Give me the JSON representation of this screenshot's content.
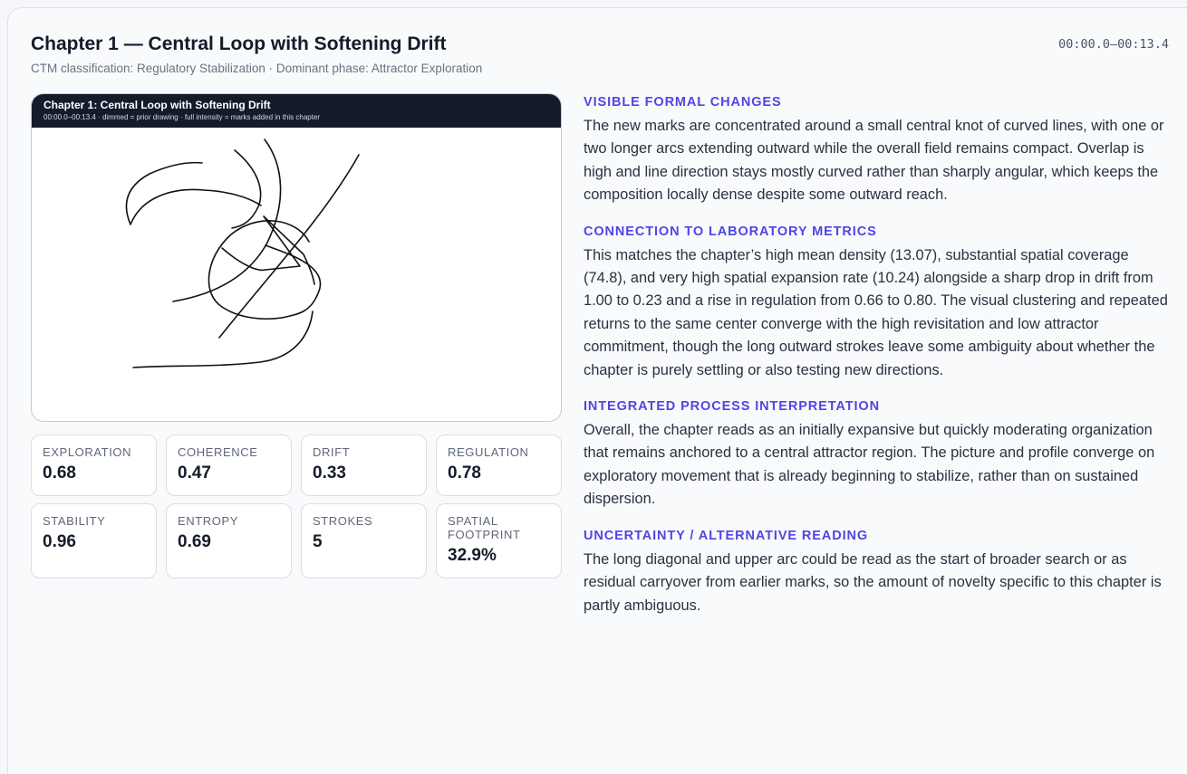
{
  "header": {
    "title": "Chapter 1 — Central Loop with Softening Drift",
    "time_range": "00:00.0–00:13.4",
    "subtitle": "CTM classification: Regulatory Stabilization · Dominant phase: Attractor Exploration"
  },
  "drawing": {
    "title": "Chapter 1: Central Loop with Softening Drift",
    "caption": "00:00.0–00:13.4  ·  dimmed = prior drawing  ·  full intensity = marks added in this chapter",
    "stroke_color": "#111111"
  },
  "metrics": [
    {
      "label": "Exploration",
      "value": "0.68"
    },
    {
      "label": "Coherence",
      "value": "0.47"
    },
    {
      "label": "Drift",
      "value": "0.33"
    },
    {
      "label": "Regulation",
      "value": "0.78"
    },
    {
      "label": "Stability",
      "value": "0.96"
    },
    {
      "label": "Entropy",
      "value": "0.69"
    },
    {
      "label": "Strokes",
      "value": "5"
    },
    {
      "label": "Spatial Footprint",
      "value": "32.9%"
    }
  ],
  "sections": [
    {
      "heading": "Visible Formal Changes",
      "body": "The new marks are concentrated around a small central knot of curved lines, with one or two longer arcs extending outward while the overall field remains compact. Overlap is high and line direction stays mostly curved rather than sharply angular, which keeps the composition locally dense despite some outward reach."
    },
    {
      "heading": "Connection to Laboratory Metrics",
      "body": "This matches the chapter’s high mean density (13.07), substantial spatial coverage (74.8), and very high spatial expansion rate (10.24) alongside a sharp drop in drift from 1.00 to 0.23 and a rise in regulation from 0.66 to 0.80. The visual clustering and repeated returns to the same center converge with the high revisitation and low attractor commitment, though the long outward strokes leave some ambiguity about whether the chapter is purely settling or also testing new directions."
    },
    {
      "heading": "Integrated Process Interpretation",
      "body": "Overall, the chapter reads as an initially expansive but quickly moderating organization that remains anchored to a central attractor region. The picture and profile converge on exploratory movement that is already beginning to stabilize, rather than on sustained dispersion."
    },
    {
      "heading": "Uncertainty / Alternative Reading",
      "body": "The long diagonal and upper arc could be read as the start of broader search or as residual carryover from earlier marks, so the amount of novelty specific to this chapter is partly ambiguous."
    }
  ],
  "colors": {
    "accent": "#4f46e5",
    "header_bg": "#141b2b"
  }
}
